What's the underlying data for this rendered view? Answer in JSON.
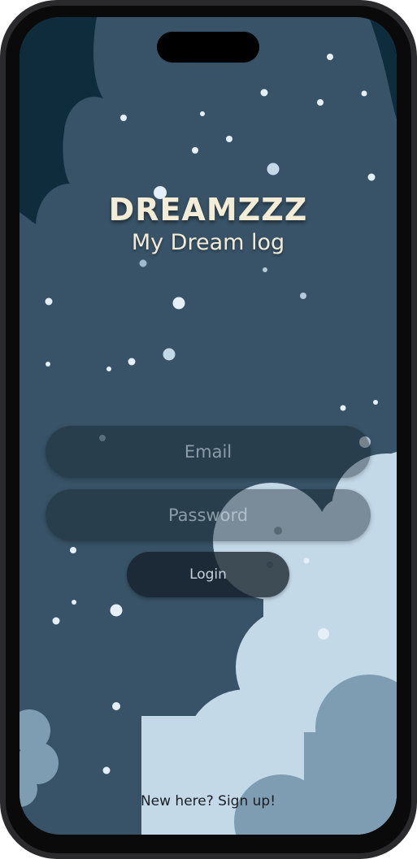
{
  "app": {
    "title": "DREAMZZZ",
    "subtitle": "My Dream log"
  },
  "form": {
    "email_placeholder": "Email",
    "password_placeholder": "Password",
    "login_label": "Login"
  },
  "footer": {
    "signup_text": "New here? Sign up!"
  },
  "colors": {
    "sky": "#385367",
    "dark_cloud": "#0f2c3d",
    "light_cloud": "#c4d9e8",
    "mid_cloud": "#7f9db2",
    "title_text": "#f3ecd6"
  }
}
